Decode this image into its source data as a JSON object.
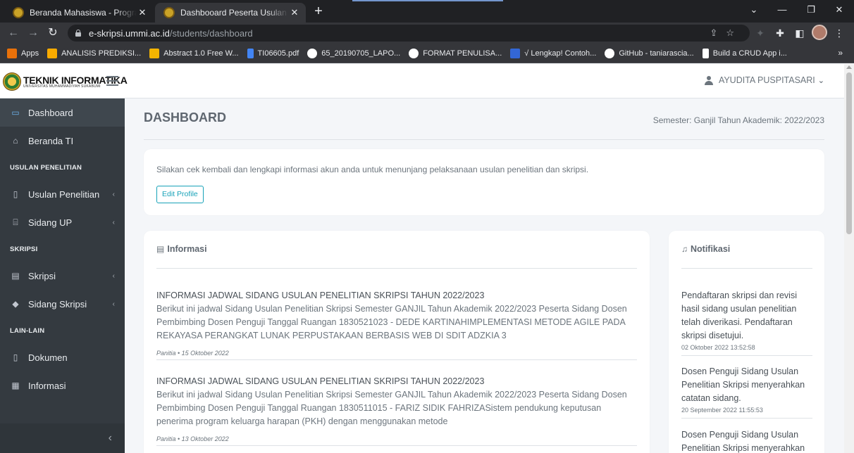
{
  "browser": {
    "tabs": [
      {
        "title": "Beranda Mahasiswa - Program St",
        "active": false
      },
      {
        "title": "Dashbooard Peserta Usulan Pene",
        "active": true
      }
    ],
    "url_host": "e-skripsi.ummi.ac.id",
    "url_path": "/students/dashboard",
    "bookmarks": [
      {
        "label": "Apps",
        "color": "#e8710a"
      },
      {
        "label": "ANALISIS PREDIKSI...",
        "color": "#f9ab00"
      },
      {
        "label": "Abstract 1.0 Free W...",
        "color": "#f4b400"
      },
      {
        "label": "TI06605.pdf",
        "color": "#4285f4"
      },
      {
        "label": "65_20190705_LAPO...",
        "color": "#ffffff"
      },
      {
        "label": "FORMAT PENULISA...",
        "color": "#ffffff"
      },
      {
        "label": "√ Lengkap! Contoh...",
        "color": "#3367d6"
      },
      {
        "label": "GitHub - taniarascia...",
        "color": "#ffffff"
      },
      {
        "label": "Build a CRUD App i...",
        "color": "#ffffff"
      }
    ]
  },
  "brand": {
    "name": "TEKNIK INFORMATIKA",
    "sub": "UNIVERSITAS MUHAMMADIYAH SUKABUMI"
  },
  "user": {
    "name": "AYUDITA PUSPITASARI"
  },
  "sidebar": {
    "items": [
      {
        "label": "Dashboard",
        "icon": "desktop-icon"
      },
      {
        "label": "Beranda TI",
        "icon": "home-icon"
      },
      {
        "label": "Usulan Penelitian",
        "icon": "file-icon"
      },
      {
        "label": "Sidang UP",
        "icon": "university-icon"
      },
      {
        "label": "Skripsi",
        "icon": "book-icon"
      },
      {
        "label": "Sidang Skripsi",
        "icon": "graduation-cap-icon"
      },
      {
        "label": "Dokumen",
        "icon": "document-icon"
      },
      {
        "label": "Informasi",
        "icon": "newspaper-icon"
      }
    ],
    "headers": [
      "USULAN PENELITIAN",
      "SKRIPSI",
      "LAIN-LAIN"
    ]
  },
  "main": {
    "title": "DASHBOARD",
    "semester": "Semester: Ganjil Tahun Akademik: 2022/2023",
    "intro": "Silakan cek kembali dan lengkapi informasi akun anda untuk menunjang pelaksanaan usulan penelitian dan skripsi.",
    "edit_profile": "Edit Profile"
  },
  "informasi": {
    "heading": "Informasi",
    "items": [
      {
        "title": "INFORMASI JADWAL SIDANG USULAN PENELITIAN SKRIPSI TAHUN 2022/2023",
        "body": "Berikut ini jadwal Sidang Usulan Penelitian Skripsi Semester GANJIL Tahun Akademik 2022/2023 Peserta Sidang Dosen Pembimbing Dosen Penguji Tanggal Ruangan 1830521023 - DEDE KARTINAHIMPLEMENTASI METODE AGILE PADA REKAYASA PERANGKAT LUNAK PERPUSTAKAAN BERBASIS WEB DI SDIT ADZKIA 3",
        "meta": "Panitia • 15 Oktober 2022"
      },
      {
        "title": "INFORMASI JADWAL SIDANG USULAN PENELITIAN SKRIPSI TAHUN 2022/2023",
        "body": "Berikut ini jadwal Sidang Usulan Penelitian Skripsi Semester GANJIL Tahun Akademik 2022/2023 Peserta Sidang Dosen Pembimbing Dosen Penguji Tanggal Ruangan 1830511015 - FARIZ SIDIK FAHRIZASistem pendukung keputusan penerima program keluarga harapan (PKH) dengan menggunakan metode",
        "meta": "Panitia • 13 Oktober 2022"
      }
    ]
  },
  "notifikasi": {
    "heading": "Notifikasi",
    "items": [
      {
        "text": "Pendaftaran skripsi dan revisi hasil sidang usulan penelitian telah diverikasi. Pendaftaran skripsi disetujui.",
        "time": "02 Oktober 2022 13:52:58"
      },
      {
        "text": "Dosen Penguji Sidang Usulan Penelitian Skripsi menyerahkan catatan sidang.",
        "time": "20 September 2022 11:55:53"
      },
      {
        "text": "Dosen Penguji Sidang Usulan Penelitian Skripsi menyerahkan",
        "time": ""
      }
    ]
  }
}
